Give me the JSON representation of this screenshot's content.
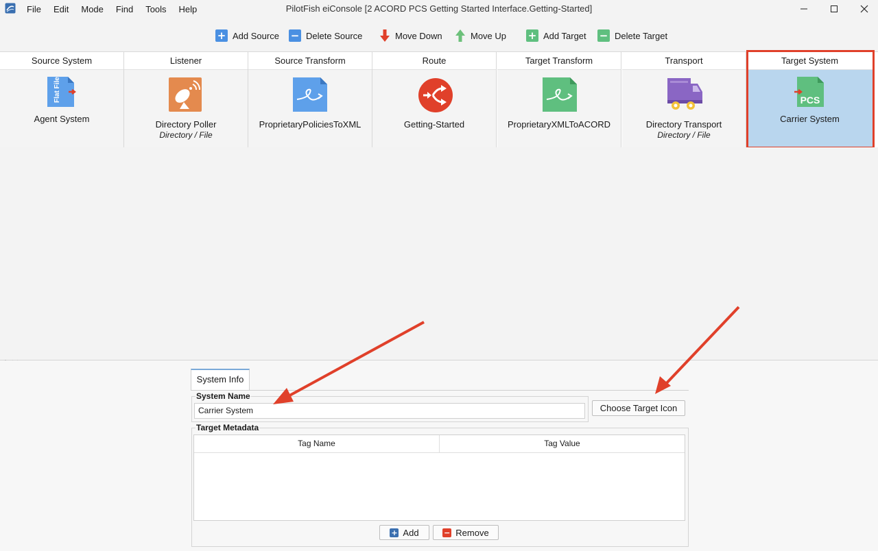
{
  "window": {
    "title": "PilotFish eiConsole [2 ACORD PCS Getting Started Interface.Getting-Started]",
    "menu": [
      "File",
      "Edit",
      "Mode",
      "Find",
      "Tools",
      "Help"
    ]
  },
  "toolbar": {
    "add_source": "Add Source",
    "delete_source": "Delete Source",
    "move_down": "Move Down",
    "move_up": "Move Up",
    "add_target": "Add Target",
    "delete_target": "Delete Target"
  },
  "pipeline": {
    "stages": [
      {
        "header": "Source System",
        "label": "Agent System",
        "sub": ""
      },
      {
        "header": "Listener",
        "label": "Directory Poller",
        "sub": "Directory / File"
      },
      {
        "header": "Source Transform",
        "label": "ProprietaryPoliciesToXML",
        "sub": ""
      },
      {
        "header": "Route",
        "label": "Getting-Started",
        "sub": ""
      },
      {
        "header": "Target Transform",
        "label": "ProprietaryXMLToACORD",
        "sub": ""
      },
      {
        "header": "Transport",
        "label": "Directory Transport",
        "sub": "Directory / File"
      },
      {
        "header": "Target System",
        "label": "Carrier System",
        "sub": ""
      }
    ],
    "icon_texts": {
      "flat_file": "Flat File",
      "pcs": "PCS"
    }
  },
  "panel": {
    "tab": "System Info",
    "system_name_label": "System Name",
    "system_name_value": "Carrier System",
    "choose_icon": "Choose Target Icon",
    "metadata_label": "Target Metadata",
    "columns": [
      "Tag Name",
      "Tag Value"
    ],
    "add": "Add",
    "remove": "Remove"
  },
  "colors": {
    "accent_blue": "#4a90e2",
    "selection": "#b9d6ee",
    "highlight_red": "#e0402a",
    "green": "#5fbf7f"
  }
}
